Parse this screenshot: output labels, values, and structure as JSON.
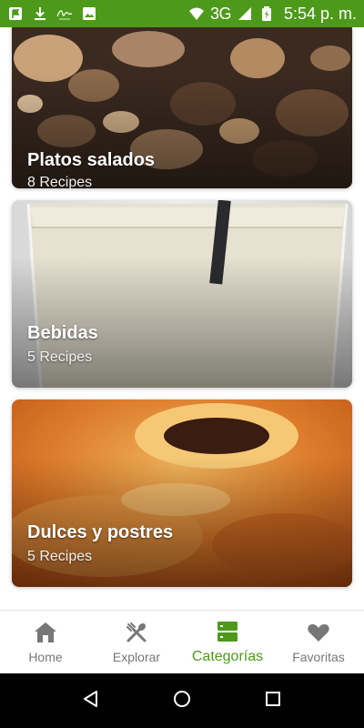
{
  "status_bar": {
    "network": "3G",
    "time": "5:54 p. m.",
    "bg_color": "#4d9a1a",
    "left_icons": [
      "flag-notification-icon",
      "download-icon",
      "signature-app-icon",
      "image-notification-icon"
    ],
    "right_icons": [
      "wifi-icon",
      "cell-signal-icon",
      "battery-icon"
    ]
  },
  "categories": [
    {
      "title": "Platos salados",
      "count": "8 Recipes",
      "image": "sauteed-mushrooms-photo"
    },
    {
      "title": "Bebidas",
      "count": "5 Recipes",
      "image": "milk-drink-with-straw-photo"
    },
    {
      "title": "Dulces y postres",
      "count": "5 Recipes",
      "image": "flan-caramel-photo"
    }
  ],
  "bottom_nav": {
    "accent_color": "#4d9a1a",
    "inactive_color": "#777777",
    "items": [
      {
        "label": "Home",
        "icon": "home-icon",
        "active": false
      },
      {
        "label": "Explorar",
        "icon": "fork-spoon-icon",
        "active": false
      },
      {
        "label": "Categorías",
        "icon": "categories-icon",
        "active": true
      },
      {
        "label": "Favoritas",
        "icon": "heart-icon",
        "active": false
      }
    ]
  },
  "system_nav": [
    "back-icon",
    "home-circle-icon",
    "recents-icon"
  ]
}
